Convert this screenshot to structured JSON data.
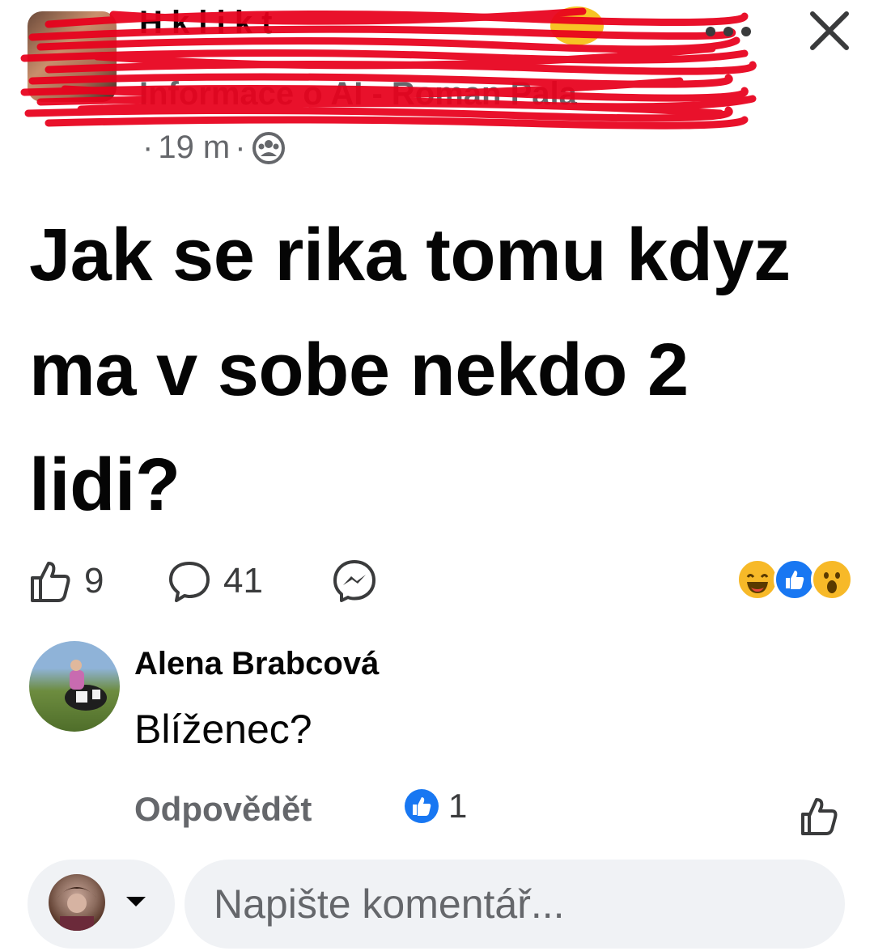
{
  "header": {
    "group_name": "H      k     l   i   k   t",
    "author_line": "Informace o AI - Roman Pala",
    "more_icon": "more-horizontal-icon",
    "close_icon": "close-icon"
  },
  "meta": {
    "separator_1": "·",
    "time": "19 m",
    "separator_2": "·",
    "privacy_icon": "privacy-group-icon"
  },
  "post": {
    "text": "Jak se rika tomu kdyz ma v sobe nekdo 2 lidi?"
  },
  "actions": {
    "like_count": "9",
    "comment_count": "41",
    "like_icon": "thumbs-up-outline-icon",
    "comment_icon": "comment-bubble-icon",
    "share_icon": "messenger-icon"
  },
  "reactions_summary": [
    "haha",
    "like",
    "wow"
  ],
  "comment": {
    "author": "Alena Brabcová",
    "text": "Blíženec?",
    "reply_label": "Odpovědět",
    "reaction_count": "1"
  },
  "composer": {
    "placeholder": "Napište komentář..."
  },
  "colors": {
    "accent_blue": "#1877f2",
    "secondary_text": "#65676b",
    "redaction": "#e8001c"
  }
}
